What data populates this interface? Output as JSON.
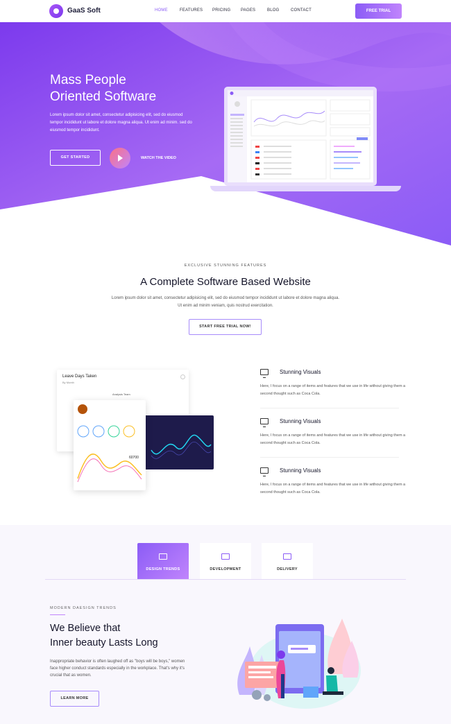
{
  "brand": {
    "name": "GaaS Soft"
  },
  "nav": {
    "items": [
      "HOME",
      "FEATURES",
      "PRICING",
      "PAGES",
      "BLOG",
      "CONTACT"
    ],
    "cta": "FREE TRIAL"
  },
  "hero": {
    "title_line1": "Mass People",
    "title_line2": "Oriented Software",
    "text": "Lorem ipsum dolor sit amet, consectetur adipisicing elit, sed do eiusmod tempor incididunt ut labore et dolore magna aliqua. Ut enim ad minim. sed do eiusmod tempor incididunt.",
    "primary_button": "GET STARTED",
    "video_label": "WATCH THE VIDEO"
  },
  "features": {
    "eyebrow": "EXCLUSIVE STUNNING FEATURES",
    "title": "A Complete Software Based Website",
    "text": "Lorem ipsum dolor sit amet, consectetur adipisicing elit, sed do eiusmod tempor incididunt ut labore et dolore magna aliqua. Ut enim ad minim veniam, quis nostrud exercitation.",
    "button": "START FREE TRIAL NOW!",
    "card": {
      "title": "Leave Days Taken",
      "subtitle": "By Month",
      "analysis": "Analysis Team",
      "value": "60700"
    },
    "items": [
      {
        "title": "Stunning Visuals",
        "text": "Here, I focus on a range of items and features that we use in life without giving them a second thought such as Coca Cola."
      },
      {
        "title": "Stunning Visuals",
        "text": "Here, I focus on a range of items and features that we use in life without giving them a second thought such as Coca Cola."
      },
      {
        "title": "Stunning Visuals",
        "text": "Here, I focus on a range of items and features that we use in life without giving them a second thought such as Coca Cola."
      }
    ]
  },
  "tabs": {
    "items": [
      "DESIGN TRENDS",
      "DEVELOPMENT",
      "DELIVERY"
    ],
    "active": "DESIGN TRENDS"
  },
  "trends": {
    "eyebrow": "MODERN DAESIGN TRENDS",
    "title_line1": "We Believe that",
    "title_line2": "Inner beauty Lasts Long",
    "text": "Inappropriate behavior is often laughed off as \"boys will be boys,\" women face higher conduct standards especially in the workplace. That's why it's crucial that as women.",
    "button": "LEARN MORE"
  },
  "colors": {
    "accent": "#8b5cf6",
    "accent_light": "#c084fc",
    "hero_start": "#7c3aed",
    "hero_end": "#b66cf6"
  }
}
